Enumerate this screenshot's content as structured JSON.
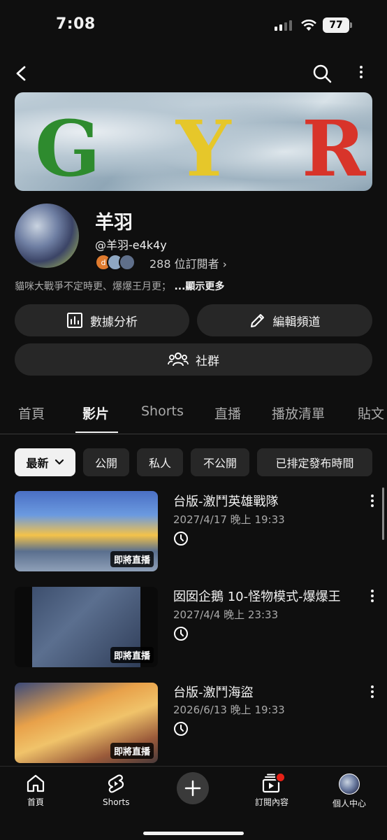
{
  "status_bar": {
    "time": "7:08",
    "battery": "77"
  },
  "banner": {
    "letters": [
      "G",
      "Y",
      "R"
    ],
    "colors": [
      "#2e8b2e",
      "#e6c72a",
      "#d8342a"
    ]
  },
  "channel": {
    "name": "羊羽",
    "handle": "@羊羽-e4k4y",
    "subscribers": "288 位訂閱者",
    "description": "貓咪大戰爭不定時更、爆爆王月更；",
    "show_more": "...顯示更多"
  },
  "buttons": {
    "analytics": "數據分析",
    "edit": "編輯頻道",
    "community": "社群"
  },
  "tabs": [
    "首頁",
    "影片",
    "Shorts",
    "直播",
    "播放清單",
    "貼文"
  ],
  "chips": [
    "最新",
    "公開",
    "私人",
    "不公開",
    "已排定發布時間"
  ],
  "videos": [
    {
      "title": "台版-激鬥英雄戰隊",
      "date": "2027/4/17 晚上 19:33",
      "badge": "即將直播"
    },
    {
      "title": "囡囡企鵝 10-怪物模式-爆爆王",
      "date": "2027/4/4 晚上 23:33",
      "badge": "即將直播"
    },
    {
      "title": "台版-激鬥海盜",
      "date": "2026/6/13 晚上 19:33",
      "badge": "即將直播"
    }
  ],
  "nav": {
    "home": "首頁",
    "shorts": "Shorts",
    "subscriptions": "訂閱內容",
    "you": "個人中心"
  },
  "colors": {
    "background": "#0f0f0f",
    "chip": "#272727",
    "notification": "#e62117"
  }
}
